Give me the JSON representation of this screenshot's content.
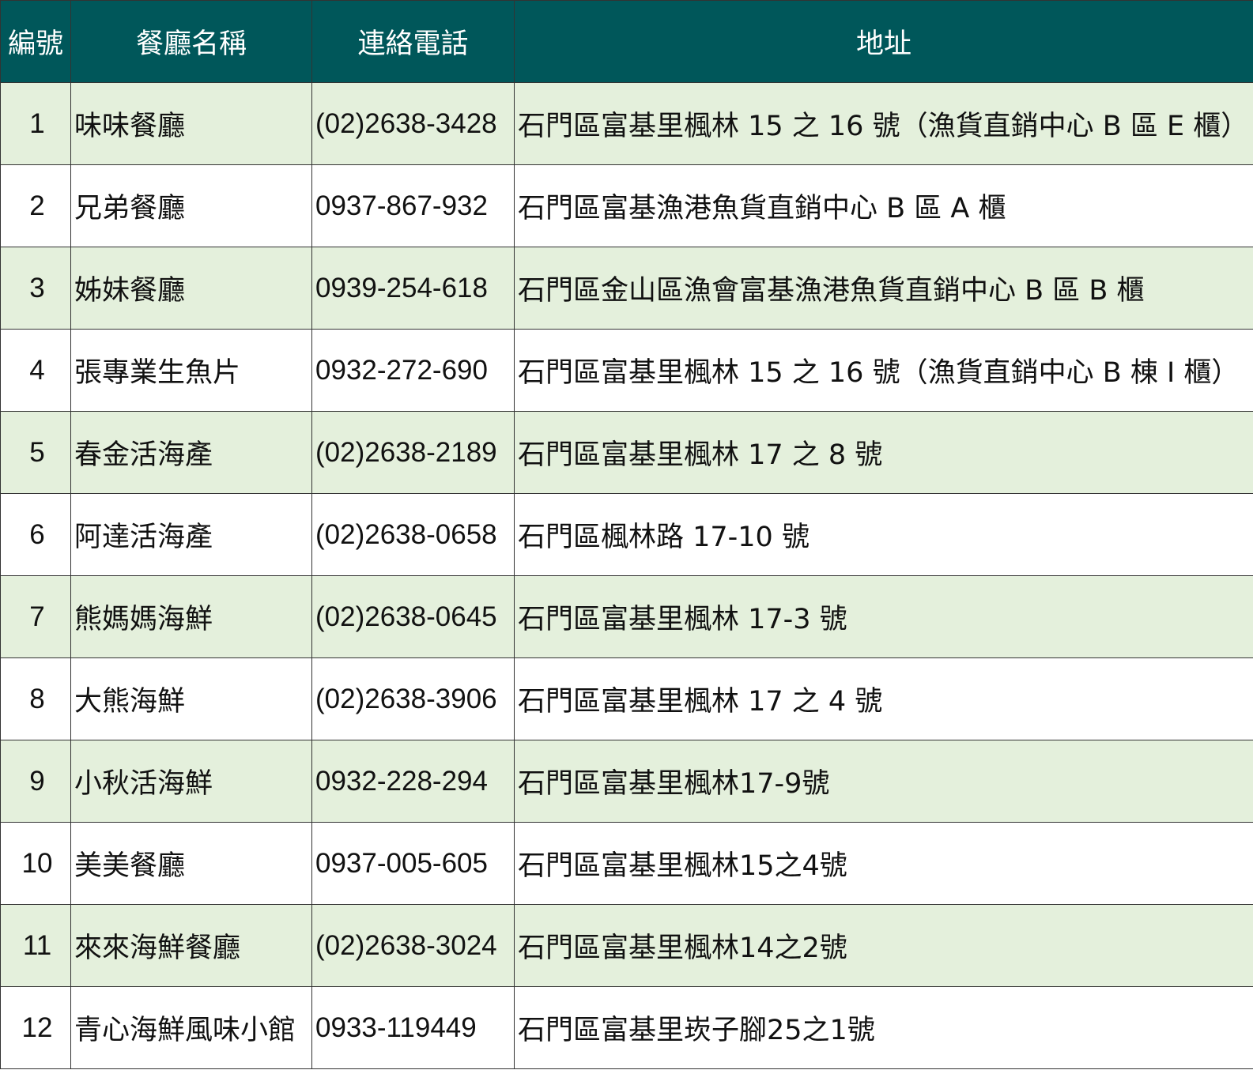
{
  "headers": {
    "no": "編號",
    "name": "餐廳名稱",
    "phone": "連絡電話",
    "address": "地址"
  },
  "rows": [
    {
      "no": "1",
      "name": "味味餐廳",
      "phone": "(02)2638-3428",
      "address": "石門區富基里楓林 15 之 16 號（漁貨直銷中心 B 區 E 櫃）"
    },
    {
      "no": "2",
      "name": "兄弟餐廳",
      "phone": "0937-867-932",
      "address": "石門區富基漁港魚貨直銷中心 B 區 A 櫃"
    },
    {
      "no": "3",
      "name": "姊妹餐廳",
      "phone": "0939-254-618",
      "address": "石門區金山區漁會富基漁港魚貨直銷中心 B 區 B 櫃"
    },
    {
      "no": "4",
      "name": "張專業生魚片",
      "phone": "0932-272-690",
      "address": "石門區富基里楓林 15 之 16 號（漁貨直銷中心 B 棟 I 櫃）"
    },
    {
      "no": "5",
      "name": "春金活海產",
      "phone": "(02)2638-2189",
      "address": "石門區富基里楓林 17 之 8 號"
    },
    {
      "no": "6",
      "name": "阿達活海產",
      "phone": "(02)2638-0658",
      "address": "石門區楓林路 17-10 號"
    },
    {
      "no": "7",
      "name": "熊媽媽海鮮",
      "phone": "(02)2638-0645",
      "address": "石門區富基里楓林 17-3 號"
    },
    {
      "no": "8",
      "name": "大熊海鮮",
      "phone": "(02)2638-3906",
      "address": "石門區富基里楓林 17 之 4 號"
    },
    {
      "no": "9",
      "name": "小秋活海鮮",
      "phone": "0932-228-294",
      "address": "石門區富基里楓林17-9號"
    },
    {
      "no": "10",
      "name": "美美餐廳",
      "phone": "0937-005-605",
      "address": "石門區富基里楓林15之4號"
    },
    {
      "no": "11",
      "name": "來來海鮮餐廳",
      "phone": "(02)2638-3024",
      "address": "石門區富基里楓林14之2號"
    },
    {
      "no": "12",
      "name": "青心海鮮風味小館",
      "phone": "0933-119449",
      "address": "石門區富基里崁子腳25之1號"
    }
  ],
  "colors": {
    "header_bg": "#00575a",
    "row_shaded": "#e4f0dc",
    "row_plain": "#ffffff"
  }
}
